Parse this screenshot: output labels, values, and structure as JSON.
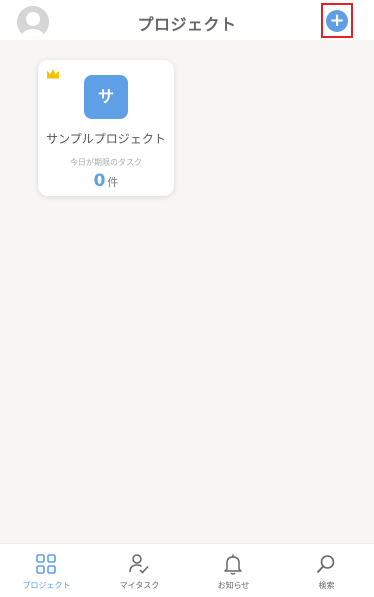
{
  "header": {
    "title": "プロジェクト",
    "add_label": "+"
  },
  "project": {
    "initial": "サ",
    "name": "サンプルプロジェクト",
    "today_label": "今日が期限のタスク",
    "task_count": "0",
    "task_unit": "件"
  },
  "tabs": [
    {
      "label": "プロジェクト",
      "icon": "grid-icon",
      "active": true
    },
    {
      "label": "マイタスク",
      "icon": "user-check-icon",
      "active": false
    },
    {
      "label": "お知らせ",
      "icon": "bell-icon",
      "active": false
    },
    {
      "label": "検索",
      "icon": "search-icon",
      "active": false
    }
  ],
  "colors": {
    "accent": "#5f9fe6",
    "highlight_frame": "#e0202a",
    "crown": "#f2c400"
  }
}
